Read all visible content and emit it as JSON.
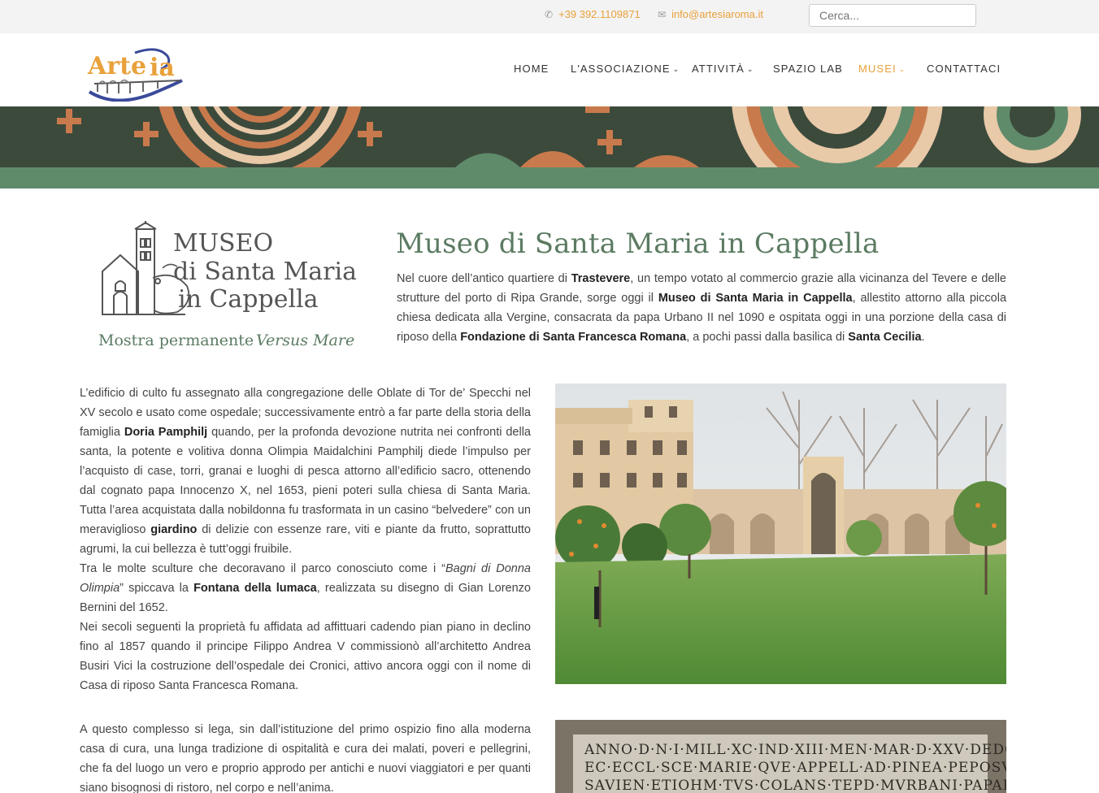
{
  "topbar": {
    "phone": "+39 392.1109871",
    "email": "info@artesiaroma.it",
    "search_placeholder": "Cerca..."
  },
  "brand": {
    "logo_text": "ArteSia"
  },
  "nav": [
    {
      "label": "HOME",
      "dropdown": false
    },
    {
      "label": "L'ASSOCIAZIONE",
      "dropdown": true
    },
    {
      "label": "ATTIVITÀ",
      "dropdown": true
    },
    {
      "label": "SPAZIO LAB",
      "dropdown": false
    },
    {
      "label": "MUSEI",
      "dropdown": true,
      "active": true
    },
    {
      "label": "CONTATTACI",
      "dropdown": false
    }
  ],
  "museum_logo": {
    "line1": "MUSEO",
    "line2": "di Santa Maria",
    "line3": "in Cappella",
    "tagline_plain": "Mostra permanente",
    "tagline_italic": "Versus Mare"
  },
  "page": {
    "title": "Museo di Santa Maria in Cappella"
  },
  "colors": {
    "accent": "#e9a13b",
    "title_green": "#5b7b62",
    "banner_dark": "#3c4a3c",
    "banner_green": "#5f8b6b"
  },
  "icons": [
    "phone-icon",
    "envelope-icon",
    "chevron-down-icon"
  ]
}
